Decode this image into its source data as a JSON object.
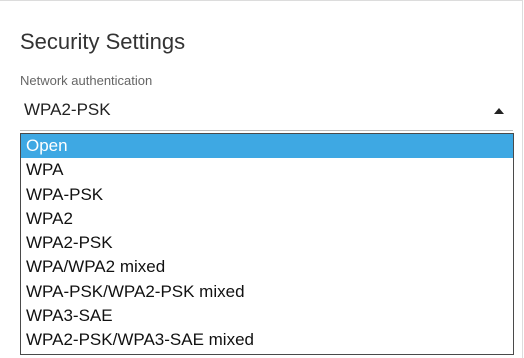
{
  "section": {
    "title": "Security Settings"
  },
  "auth": {
    "label": "Network authentication",
    "selected_value": "WPA2-PSK",
    "highlighted_option": "Open",
    "options": [
      "Open",
      "WPA",
      "WPA-PSK",
      "WPA2",
      "WPA2-PSK",
      "WPA/WPA2 mixed",
      "WPA-PSK/WPA2-PSK mixed",
      "WPA3-SAE",
      "WPA2-PSK/WPA3-SAE mixed"
    ]
  },
  "colors": {
    "highlight": "#3ea8e3",
    "highlight_text": "#ffffff",
    "text": "#222222"
  },
  "icons": {
    "dropdown_toggle": "caret-up-icon"
  }
}
